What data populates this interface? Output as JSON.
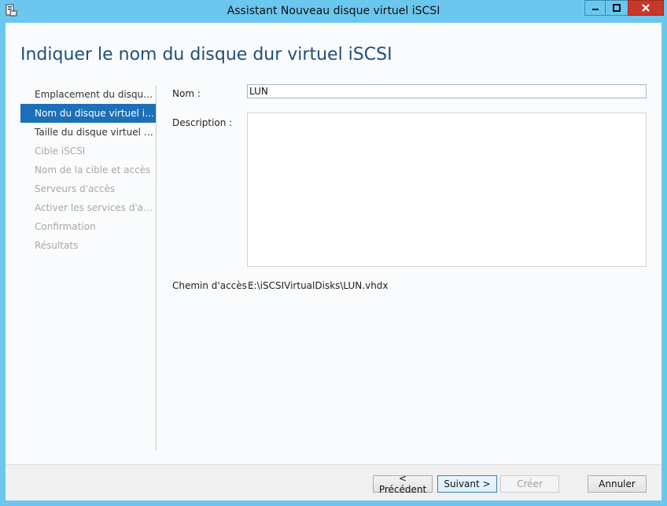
{
  "window": {
    "title": "Assistant Nouveau disque virtuel iSCSI",
    "icon": "server-manager-icon",
    "controls": [
      "minimize-icon",
      "maximize-icon",
      "close-icon"
    ],
    "accent_color": "#6bc7ee"
  },
  "page": {
    "title": "Indiquer le nom du disque dur virtuel iSCSI"
  },
  "nav": {
    "items": [
      {
        "label": "Emplacement du disque virtuel iSCSI",
        "state": "normal"
      },
      {
        "label": "Nom du disque virtuel iSCSI",
        "state": "active"
      },
      {
        "label": "Taille du disque virtuel iSCSI",
        "state": "normal"
      },
      {
        "label": "Cible iSCSI",
        "state": "disabled"
      },
      {
        "label": "Nom de la cible et accès",
        "state": "disabled"
      },
      {
        "label": "Serveurs d'accès",
        "state": "disabled"
      },
      {
        "label": "Activer les services d'authentification",
        "state": "disabled"
      },
      {
        "label": "Confirmation",
        "state": "disabled"
      },
      {
        "label": "Résultats",
        "state": "disabled"
      }
    ]
  },
  "form": {
    "name_label": "Nom :",
    "name_value": "LUN",
    "description_label": "Description :",
    "description_value": "",
    "path_label": "Chemin d'accès :",
    "path_value": "E:\\iSCSIVirtualDisks\\LUN.vhdx"
  },
  "footer": {
    "previous": "< Précédent",
    "next": "Suivant >",
    "create": "Créer",
    "cancel": "Annuler"
  }
}
